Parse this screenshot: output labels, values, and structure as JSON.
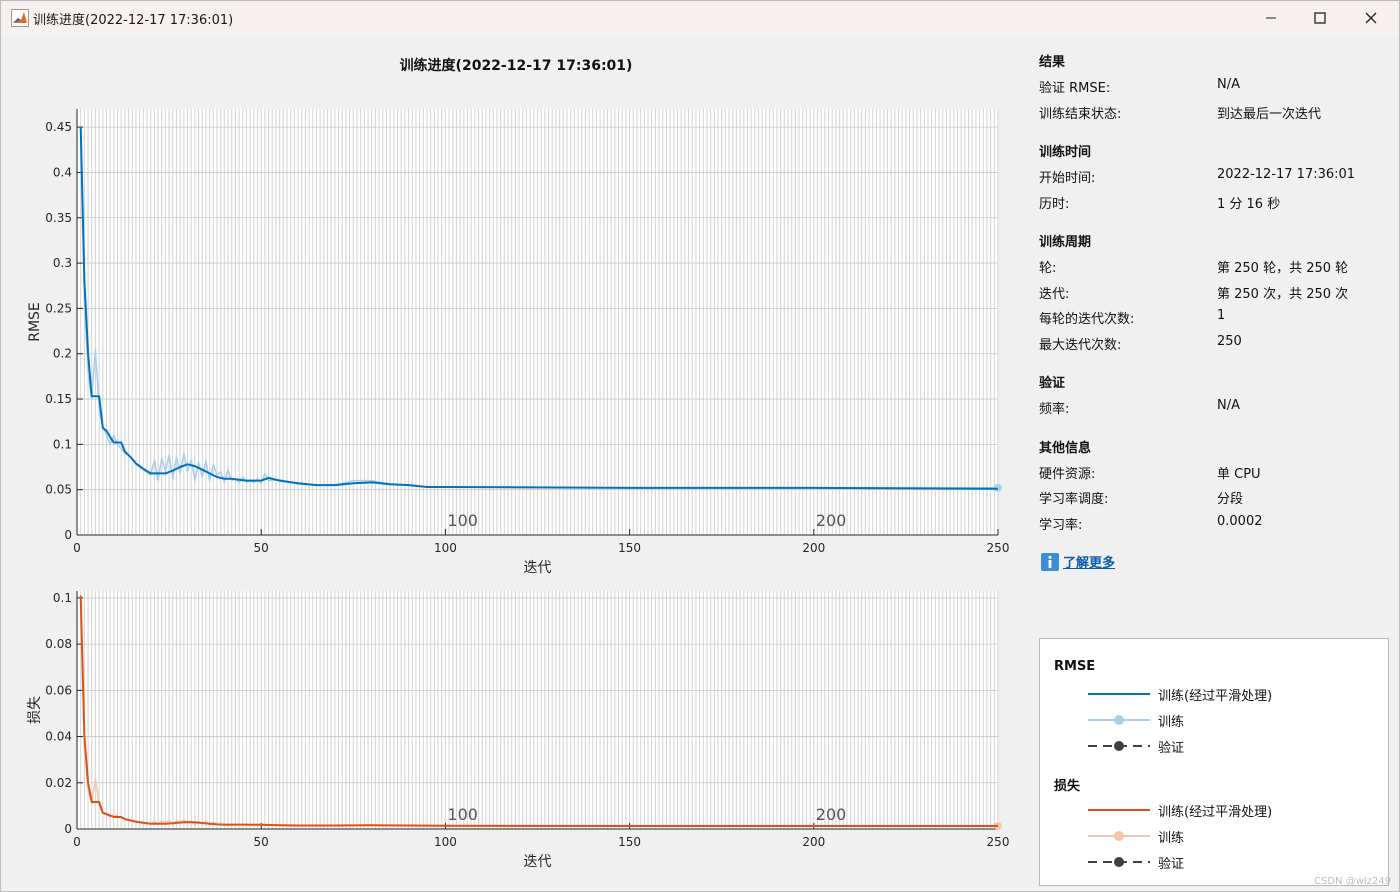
{
  "window": {
    "title": "训练进度(2022-12-17 17:36:01)",
    "minimize_icon": "minimize-icon",
    "maximize_icon": "maximize-icon",
    "close_icon": "close-icon"
  },
  "main_title": "训练进度(2022-12-17 17:36:01)",
  "info_panel": {
    "sections": [
      {
        "title": "结果",
        "rows": [
          {
            "label": "验证 RMSE:",
            "value": "N/A"
          },
          {
            "label": "训练结束状态:",
            "value": "到达最后一次迭代"
          }
        ]
      },
      {
        "title": "训练时间",
        "rows": [
          {
            "label": "开始时间:",
            "value": "2022-12-17 17:36:01"
          },
          {
            "label": "历时:",
            "value": "1 分 16 秒"
          }
        ]
      },
      {
        "title": "训练周期",
        "rows": [
          {
            "label": "轮:",
            "value": "第 250 轮，共 250 轮"
          },
          {
            "label": "迭代:",
            "value": "第 250 次，共 250 次"
          },
          {
            "label": "每轮的迭代次数:",
            "value": "1"
          },
          {
            "label": "最大迭代次数:",
            "value": "250"
          }
        ]
      },
      {
        "title": "验证",
        "rows": [
          {
            "label": "频率:",
            "value": "N/A"
          }
        ]
      },
      {
        "title": "其他信息",
        "rows": [
          {
            "label": "硬件资源:",
            "value": "单 CPU"
          },
          {
            "label": "学习率调度:",
            "value": "分段"
          },
          {
            "label": "学习率:",
            "value": "0.0002"
          }
        ]
      }
    ],
    "learn_more": "了解更多",
    "learn_more_icon": "info-icon"
  },
  "legend": {
    "groups": [
      {
        "title": "RMSE",
        "items": [
          {
            "label": "训练(经过平滑处理)",
            "style": "solid",
            "color": "#0072BD"
          },
          {
            "label": "训练",
            "style": "marker",
            "color": "#A9CFEA"
          },
          {
            "label": "验证",
            "style": "dashed",
            "color": "#404040"
          }
        ]
      },
      {
        "title": "损失",
        "items": [
          {
            "label": "训练(经过平滑处理)",
            "style": "solid",
            "color": "#D95319"
          },
          {
            "label": "训练",
            "style": "marker",
            "color": "#F4C6AE"
          },
          {
            "label": "验证",
            "style": "dashed",
            "color": "#404040"
          }
        ]
      }
    ]
  },
  "watermark": "CSDN @wlz249",
  "chart_data": [
    {
      "type": "line",
      "xlabel": "迭代",
      "ylabel": "RMSE",
      "xlim": [
        0,
        250
      ],
      "ylim": [
        0,
        0.47
      ],
      "xticks": [
        0,
        50,
        100,
        150,
        200,
        250
      ],
      "yticks": [
        0,
        0.05,
        0.1,
        0.15,
        0.2,
        0.25,
        0.3,
        0.35,
        0.4,
        0.45
      ],
      "ytick_labels": [
        "0",
        "0.05",
        "0.1",
        "0.15",
        "0.2",
        "0.25",
        "0.3",
        "0.35",
        "0.4",
        "0.45"
      ],
      "epoch_markers": [
        {
          "x": 100,
          "label": "100"
        },
        {
          "x": 200,
          "label": "200"
        }
      ],
      "grid": true,
      "series": [
        {
          "name": "训练(经过平滑处理)",
          "color": "#0072BD",
          "x": [
            1,
            2,
            3,
            4,
            5,
            6,
            7,
            8,
            9,
            10,
            11,
            12,
            13,
            14,
            15,
            16,
            18,
            20,
            22,
            24,
            26,
            28,
            30,
            32,
            34,
            36,
            38,
            40,
            42,
            44,
            46,
            48,
            50,
            52,
            55,
            60,
            65,
            70,
            75,
            80,
            85,
            90,
            95,
            100,
            150,
            200,
            250
          ],
          "y": [
            0.45,
            0.28,
            0.2,
            0.153,
            0.153,
            0.153,
            0.118,
            0.115,
            0.108,
            0.102,
            0.102,
            0.102,
            0.092,
            0.088,
            0.084,
            0.079,
            0.073,
            0.068,
            0.068,
            0.068,
            0.071,
            0.075,
            0.078,
            0.076,
            0.072,
            0.068,
            0.064,
            0.062,
            0.062,
            0.061,
            0.06,
            0.06,
            0.06,
            0.063,
            0.06,
            0.057,
            0.055,
            0.055,
            0.057,
            0.058,
            0.056,
            0.055,
            0.053,
            0.053,
            0.052,
            0.052,
            0.051
          ]
        },
        {
          "name": "训练",
          "color": "#A9CFEA",
          "x": [
            1,
            2,
            3,
            4,
            5,
            6,
            7,
            8,
            9,
            10,
            11,
            12,
            13,
            14,
            15,
            16,
            18,
            20,
            21,
            22,
            23,
            24,
            25,
            26,
            27,
            28,
            29,
            30,
            31,
            32,
            33,
            34,
            35,
            36,
            37,
            38,
            39,
            40,
            41,
            42,
            43,
            44,
            45,
            46,
            47,
            48,
            49,
            50,
            51,
            52,
            55,
            60,
            65,
            70,
            75,
            80,
            85,
            90,
            95,
            100,
            150,
            200,
            250
          ],
          "y": [
            0.45,
            0.26,
            0.18,
            0.15,
            0.205,
            0.14,
            0.12,
            0.11,
            0.1,
            0.11,
            0.1,
            0.095,
            0.09,
            0.088,
            0.083,
            0.078,
            0.072,
            0.066,
            0.083,
            0.06,
            0.085,
            0.07,
            0.088,
            0.062,
            0.086,
            0.068,
            0.09,
            0.07,
            0.083,
            0.06,
            0.08,
            0.064,
            0.082,
            0.06,
            0.078,
            0.066,
            0.07,
            0.058,
            0.072,
            0.06,
            0.062,
            0.058,
            0.064,
            0.058,
            0.06,
            0.058,
            0.062,
            0.057,
            0.068,
            0.06,
            0.061,
            0.056,
            0.055,
            0.055,
            0.06,
            0.06,
            0.056,
            0.055,
            0.053,
            0.053,
            0.052,
            0.052,
            0.052
          ]
        }
      ]
    },
    {
      "type": "line",
      "xlabel": "迭代",
      "ylabel": "损失",
      "xlim": [
        0,
        250
      ],
      "ylim": [
        0,
        0.103
      ],
      "xticks": [
        0,
        50,
        100,
        150,
        200,
        250
      ],
      "yticks": [
        0,
        0.02,
        0.04,
        0.06,
        0.08,
        0.1
      ],
      "ytick_labels": [
        "0",
        "0.02",
        "0.04",
        "0.06",
        "0.08",
        "0.1"
      ],
      "epoch_markers": [
        {
          "x": 100,
          "label": "100"
        },
        {
          "x": 200,
          "label": "200"
        }
      ],
      "grid": true,
      "series": [
        {
          "name": "训练(经过平滑处理)",
          "color": "#D95319",
          "x": [
            1,
            2,
            3,
            4,
            5,
            6,
            7,
            8,
            9,
            10,
            11,
            12,
            13,
            14,
            15,
            16,
            18,
            20,
            22,
            24,
            26,
            28,
            30,
            32,
            34,
            36,
            38,
            40,
            45,
            50,
            55,
            60,
            70,
            80,
            90,
            100,
            150,
            200,
            250
          ],
          "y": [
            0.101,
            0.04,
            0.02,
            0.0117,
            0.0117,
            0.0117,
            0.007,
            0.0065,
            0.0058,
            0.0052,
            0.0052,
            0.0052,
            0.0043,
            0.0039,
            0.0035,
            0.0031,
            0.0027,
            0.0023,
            0.0023,
            0.0023,
            0.0025,
            0.0028,
            0.003,
            0.0029,
            0.0026,
            0.0023,
            0.002,
            0.0019,
            0.0019,
            0.0018,
            0.0016,
            0.0015,
            0.0015,
            0.0016,
            0.0015,
            0.0014,
            0.0013,
            0.0013,
            0.0013
          ]
        },
        {
          "name": "训练",
          "color": "#F4C6AE",
          "x": [
            1,
            2,
            3,
            4,
            5,
            6,
            7,
            8,
            9,
            10,
            12,
            14,
            16,
            18,
            20,
            21,
            22,
            23,
            24,
            25,
            26,
            27,
            28,
            29,
            30,
            31,
            32,
            33,
            34,
            35,
            36,
            37,
            38,
            40,
            45,
            50,
            55,
            60,
            70,
            80,
            90,
            100,
            150,
            200,
            250
          ],
          "y": [
            0.101,
            0.035,
            0.017,
            0.011,
            0.022,
            0.01,
            0.0072,
            0.0062,
            0.0052,
            0.0062,
            0.005,
            0.004,
            0.0034,
            0.0028,
            0.0022,
            0.0035,
            0.0018,
            0.0036,
            0.0024,
            0.0038,
            0.0019,
            0.0037,
            0.0023,
            0.004,
            0.0025,
            0.0035,
            0.0018,
            0.0032,
            0.002,
            0.0034,
            0.0018,
            0.003,
            0.0022,
            0.0017,
            0.0019,
            0.0017,
            0.0016,
            0.0015,
            0.0015,
            0.0017,
            0.0015,
            0.0014,
            0.0013,
            0.0013,
            0.0013
          ]
        }
      ]
    }
  ]
}
